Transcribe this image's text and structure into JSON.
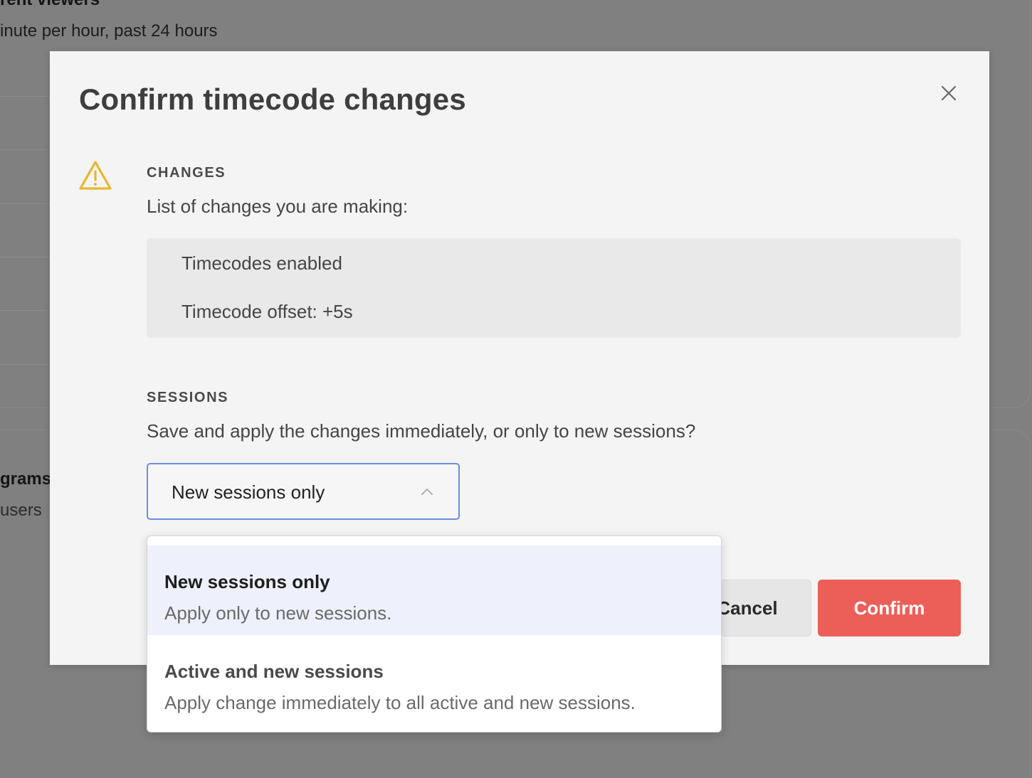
{
  "background": {
    "card1": {
      "title": "rent viewers",
      "subtitle": "inute per hour, past 24 hours"
    },
    "card2": {
      "title": "grams",
      "subtitle": "users"
    }
  },
  "modal": {
    "title": "Confirm timecode changes",
    "close_icon": "close-icon",
    "warning_icon": "warning-triangle-icon",
    "warning_color": "#e8b730",
    "changes": {
      "label": "CHANGES",
      "description": "List of changes you are making:",
      "items": [
        "Timecodes enabled",
        "Timecode offset: +5s"
      ]
    },
    "sessions": {
      "label": "SESSIONS",
      "description": "Save and apply the changes immediately, or only to new sessions?",
      "select": {
        "value": "New sessions only",
        "expanded": true
      }
    },
    "buttons": {
      "cancel_label": "Cancel",
      "confirm_label": "Confirm",
      "confirm_color": "#ec5f59"
    }
  },
  "dropdown": {
    "options": [
      {
        "title": "New sessions only",
        "description": "Apply only to new sessions.",
        "selected": true
      },
      {
        "title": "Active and new sessions",
        "description": "Apply change immediately to all active and new sessions.",
        "selected": false
      }
    ]
  }
}
